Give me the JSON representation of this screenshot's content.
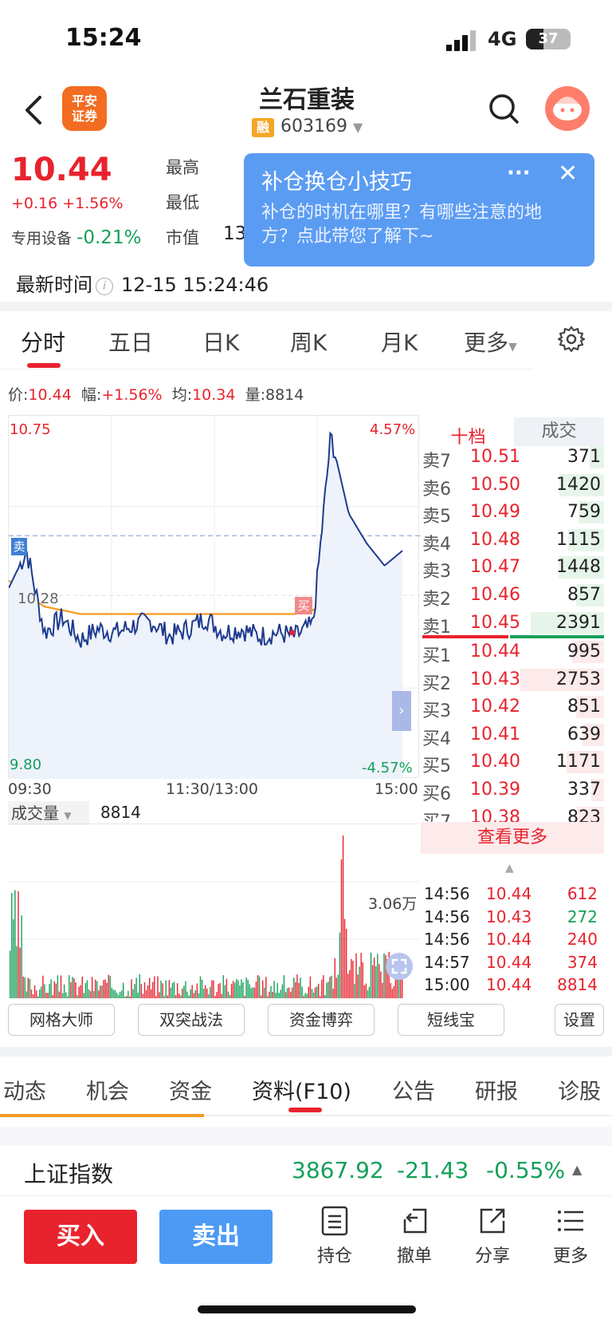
{
  "status": {
    "time": "15:24",
    "network": "4G",
    "battery": "37"
  },
  "header": {
    "broker": "平安\n证券",
    "title": "兰石重装",
    "rong": "融",
    "code": "603169"
  },
  "quote": {
    "price": "10.44",
    "change": "+0.16 +1.56%",
    "sector_name": "专用设备",
    "sector_change": "-0.21%",
    "high_label": "最高",
    "low_label": "最低",
    "cap_label": "市值",
    "cap_value_partial": "13"
  },
  "popup": {
    "title": "补仓换仓小技巧",
    "body": "补仓的时机在哪里？有哪些注意的地方？点此带您了解下~"
  },
  "update": {
    "label": "最新时间",
    "info": "i",
    "value": "12-15 15:24:46"
  },
  "ktabs": [
    "分时",
    "五日",
    "日K",
    "周K",
    "月K",
    "更多"
  ],
  "infoline": {
    "price_label": "价:",
    "price": "10.44",
    "amp_label": "幅:",
    "amp": "+1.56%",
    "avg_label": "均:",
    "avg": "10.34",
    "vol_label": "量:",
    "vol": "8814"
  },
  "chart": {
    "y_top": "10.75",
    "y_mid": "10.28",
    "y_bot": "9.80",
    "pct_top": "4.57%",
    "pct_bot": "-4.57%",
    "x_start": "09:30",
    "x_mid": "11:30/13:00",
    "x_end": "15:00",
    "sell_marker": "卖",
    "buy_marker": "买",
    "vol_label": "成交量",
    "vol_value": "8814",
    "vol_max": "3.06万"
  },
  "chart_data": {
    "type": "line",
    "title": "",
    "ylim": [
      9.8,
      10.75
    ],
    "prev_close": 10.28,
    "x": [
      "09:30",
      "11:30/13:00",
      "15:00"
    ],
    "series": [
      {
        "name": "",
        "values": [
          10.3,
          10.4,
          10.18,
          10.22,
          10.16,
          10.19,
          10.18,
          10.2,
          10.21,
          10.17,
          10.19,
          10.22,
          10.18,
          10.19,
          10.17,
          10.18,
          10.17,
          10.2,
          10.71,
          10.5,
          10.42,
          10.36,
          10.4
        ]
      },
      {
        "name": "均",
        "values": [
          10.32,
          10.28,
          10.25,
          10.24,
          10.23,
          10.23,
          10.23,
          10.23,
          10.23,
          10.23,
          10.23,
          10.23,
          10.23,
          10.23,
          10.23,
          10.23,
          10.23,
          10.24,
          10.28,
          10.31,
          10.33,
          10.34,
          10.34
        ]
      }
    ]
  },
  "orderbook": {
    "head_left": "十档",
    "head_right": "成交",
    "sell": [
      {
        "n": "卖7",
        "p": "10.51",
        "v": "371"
      },
      {
        "n": "卖6",
        "p": "10.50",
        "v": "1420"
      },
      {
        "n": "卖5",
        "p": "10.49",
        "v": "759"
      },
      {
        "n": "卖4",
        "p": "10.48",
        "v": "1115"
      },
      {
        "n": "卖3",
        "p": "10.47",
        "v": "1448"
      },
      {
        "n": "卖2",
        "p": "10.46",
        "v": "857"
      },
      {
        "n": "卖1",
        "p": "10.45",
        "v": "2391"
      }
    ],
    "buy": [
      {
        "n": "买1",
        "p": "10.44",
        "v": "995"
      },
      {
        "n": "买2",
        "p": "10.43",
        "v": "2753"
      },
      {
        "n": "买3",
        "p": "10.42",
        "v": "851"
      },
      {
        "n": "买4",
        "p": "10.41",
        "v": "639"
      },
      {
        "n": "买5",
        "p": "10.40",
        "v": "1171"
      },
      {
        "n": "买6",
        "p": "10.39",
        "v": "337"
      },
      {
        "n": "买7",
        "p": "10.38",
        "v": "823"
      }
    ],
    "more": "查看更多",
    "ticks": [
      {
        "t": "14:56",
        "p": "10.44",
        "v": "612"
      },
      {
        "t": "14:56",
        "p": "10.43",
        "v": "272"
      },
      {
        "t": "14:56",
        "p": "10.44",
        "v": "240"
      },
      {
        "t": "14:57",
        "p": "10.44",
        "v": "374"
      },
      {
        "t": "15:00",
        "p": "10.44",
        "v": "8814"
      }
    ]
  },
  "tools": [
    "网格大师",
    "双突战法",
    "资金博弈",
    "短线宝",
    "设置"
  ],
  "ltabs": [
    "动态",
    "机会",
    "资金",
    "资料(F10)",
    "公告",
    "研报",
    "诊股"
  ],
  "index": {
    "name": "上证指数",
    "value": "3867.92",
    "change": "-21.43",
    "pct": "-0.55%"
  },
  "bottom": {
    "buy": "买入",
    "sell": "卖出",
    "items": [
      "持仓",
      "撤单",
      "分享",
      "更多"
    ]
  },
  "colors": {
    "up": "#e8232e",
    "down": "#14a05a",
    "accent": "#4d9af5",
    "brand": "#f36c21"
  }
}
